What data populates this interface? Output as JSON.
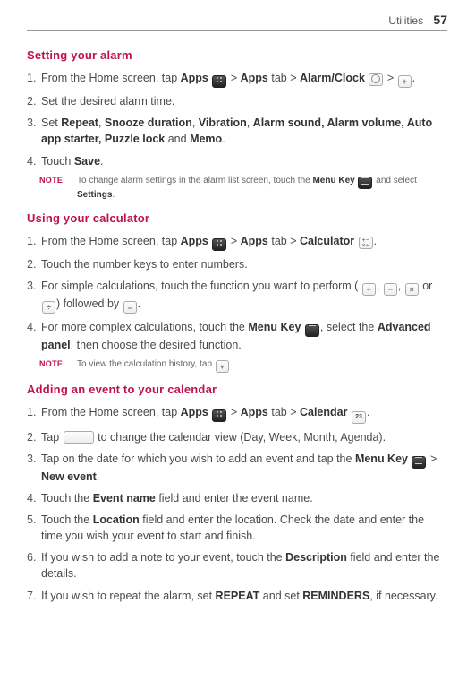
{
  "header": {
    "section": "Utilities",
    "page": "57"
  },
  "alarm": {
    "title": "Setting your alarm",
    "s1a": "From the Home screen, tap ",
    "s1_apps": "Apps",
    "s1b": " > ",
    "s1_appstab": "Apps",
    "s1c": " tab > ",
    "s1_alarm": "Alarm/Clock",
    "s1d": " > ",
    "s1e": ".",
    "s2": "Set the desired alarm time.",
    "s3a": "Set ",
    "s3_repeat": "Repeat",
    "s3b": ", ",
    "s3_snooze": "Snooze duration",
    "s3c": ", ",
    "s3_vib": "Vibration",
    "s3d": ", ",
    "s3_rest": "Alarm sound, Alarm volume, Auto app starter, Puzzle lock",
    "s3e": " and ",
    "s3_memo": "Memo",
    "s3f": ".",
    "s4a": "Touch ",
    "s4_save": "Save",
    "s4b": ".",
    "note_label": "NOTE",
    "note_a": "To change alarm settings in the alarm list screen, touch the ",
    "note_menu": "Menu Key",
    "note_b": " and select ",
    "note_settings": "Settings",
    "note_c": "."
  },
  "calc": {
    "title": "Using your calculator",
    "s1a": "From the Home screen, tap ",
    "s1_apps": "Apps",
    "s1b": " > ",
    "s1_appstab": "Apps",
    "s1c": " tab > ",
    "s1_calc": "Calculator",
    "s1d": ".",
    "s2": "Touch the number keys to enter numbers.",
    "s3a": "For simple calculations, touch the function you want to perform (",
    "s3b": ", ",
    "s3c": ", ",
    "s3d": " or ",
    "s3e": ") followed by ",
    "s3f": ".",
    "s4a": "For more complex calculations, touch the ",
    "s4_menu": "Menu Key",
    "s4b": ", select the ",
    "s4_adv": "Advanced panel",
    "s4c": ", then choose the desired function.",
    "note_label": "NOTE",
    "note_a": "To view the calculation history, tap ",
    "note_b": "."
  },
  "cal": {
    "title": "Adding an event to your calendar",
    "s1a": "From the Home screen, tap ",
    "s1_apps": "Apps",
    "s1b": " > ",
    "s1_appstab": "Apps",
    "s1c": " tab > ",
    "s1_cal": "Calendar",
    "s1d": ".",
    "s2a": "Tap ",
    "s2b": " to change the calendar view (Day, Week, Month, Agenda).",
    "s3a": "Tap on the date for which you wish to add an event and tap the ",
    "s3_menu": "Menu Key",
    "s3b": " > ",
    "s3_new": "New event",
    "s3c": ".",
    "s4a": "Touch the ",
    "s4_ev": "Event name",
    "s4b": " field and enter the event name.",
    "s5a": "Touch the ",
    "s5_loc": "Location",
    "s5b": " field and enter the location. Check the date and enter the time you wish your event to start and finish.",
    "s6a": "If you wish to add a note to your event, touch the ",
    "s6_desc": "Description",
    "s6b": " field and enter the details.",
    "s7a": "If you wish to repeat the alarm, set ",
    "s7_rep": "REPEAT",
    "s7b": " and set ",
    "s7_rem": "REMINDERS",
    "s7c": ", if necessary."
  },
  "nums": {
    "n1": "1.",
    "n2": "2.",
    "n3": "3.",
    "n4": "4.",
    "n5": "5.",
    "n6": "6.",
    "n7": "7."
  },
  "cal_icon": "23"
}
